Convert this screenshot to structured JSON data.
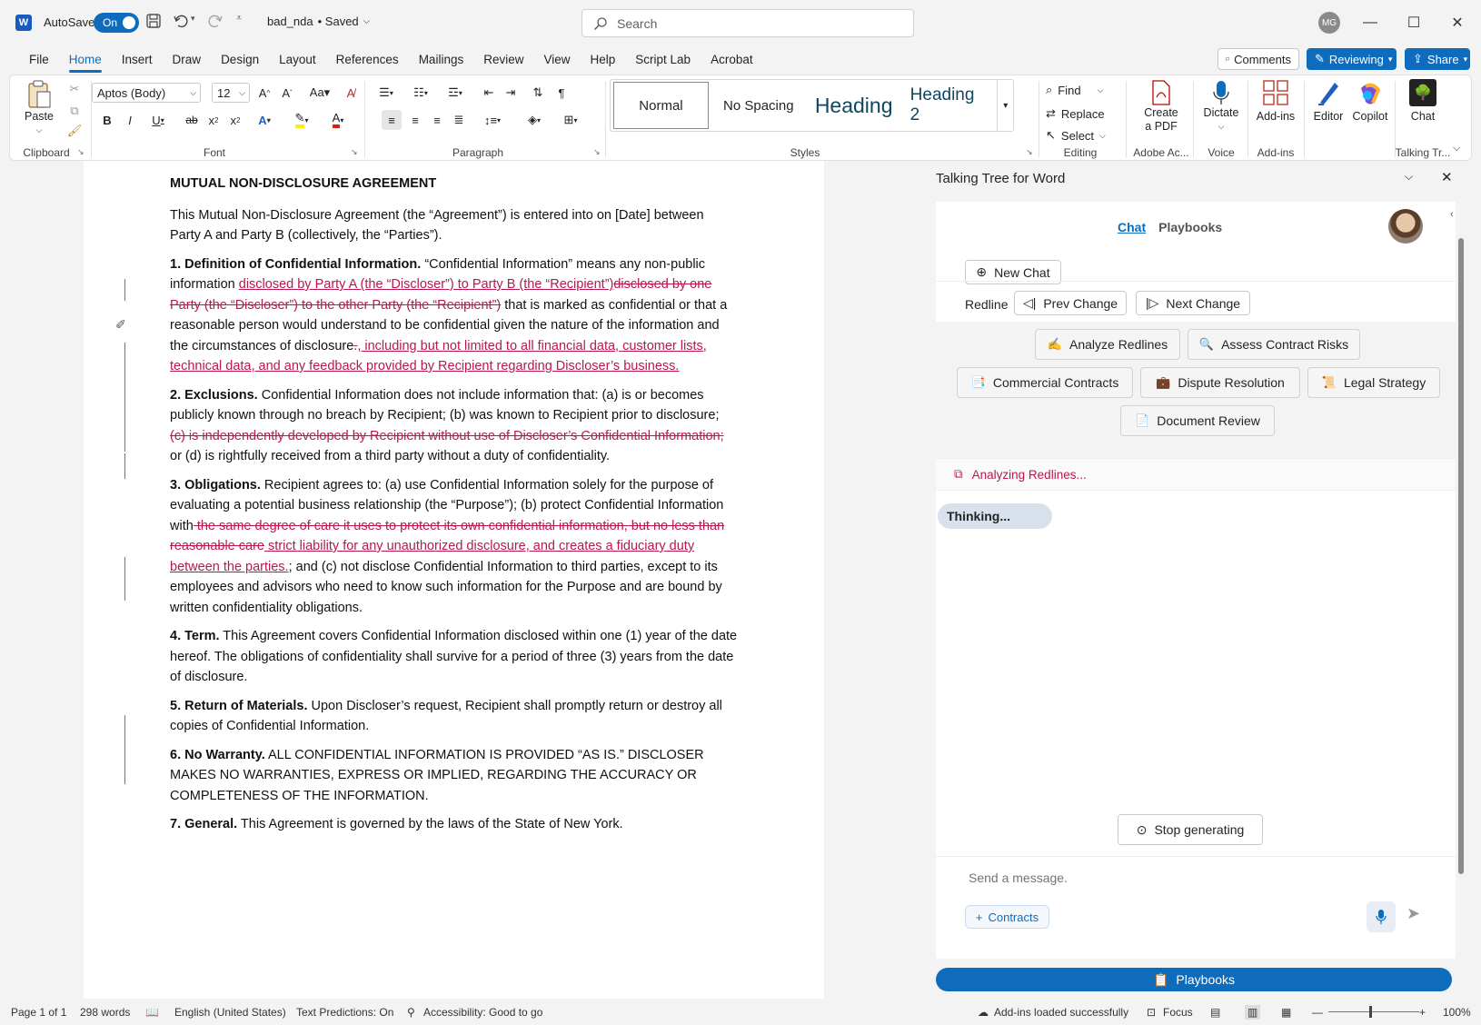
{
  "titlebar": {
    "autosave_label": "AutoSave",
    "autosave_state": "On",
    "doc_name": "bad_nda",
    "doc_status": "• Saved",
    "search_placeholder": "Search",
    "user_initials": "MG"
  },
  "menu": {
    "tabs": [
      "File",
      "Home",
      "Insert",
      "Draw",
      "Design",
      "Layout",
      "References",
      "Mailings",
      "Review",
      "View",
      "Help",
      "Script Lab",
      "Acrobat"
    ],
    "active": "Home",
    "comments": "Comments",
    "reviewing": "Reviewing",
    "share": "Share"
  },
  "ribbon": {
    "clipboard": {
      "paste": "Paste",
      "label": "Clipboard"
    },
    "font": {
      "name": "Aptos (Body)",
      "size": "12",
      "label": "Font"
    },
    "paragraph": {
      "label": "Paragraph"
    },
    "styles": {
      "items": [
        "Normal",
        "No Spacing",
        "Heading",
        "Heading 2"
      ],
      "label": "Styles"
    },
    "editing": {
      "find": "Find",
      "replace": "Replace",
      "select": "Select",
      "label": "Editing"
    },
    "adobe": {
      "create": "Create",
      "pdf": "a PDF",
      "label": "Adobe Ac..."
    },
    "voice": {
      "dictate": "Dictate",
      "label": "Voice"
    },
    "addins": {
      "addins": "Add-ins",
      "label": "Add-ins"
    },
    "editor": "Editor",
    "copilot": "Copilot",
    "talking": {
      "chat": "Chat",
      "label": "Talking Tr..."
    }
  },
  "document": {
    "title": "MUTUAL NON-DISCLOSURE AGREEMENT",
    "intro": "This Mutual Non-Disclosure Agreement (the “Agreement”) is entered into on [Date] between Party A and Party B (collectively, the “Parties”).",
    "s1": {
      "head": "1. Definition of Confidential Information.",
      "t1": " “Confidential Information” means any non-public information ",
      "ins1": "disclosed by Party A (the “Discloser”) to Party B (the “Recipient”)",
      "del1": "disclosed by one Party (the “Discloser”) to the other Party (the “Recipient”)",
      "t2": " that is marked as confidential or that a reasonable person would understand to be confidential given the nature of the information and the circumstances of disclosure",
      "del2": ".",
      "ins2": ", including but not limited to all financial data, customer lists, technical data, and any feedback provided by Recipient regarding Discloser’s business."
    },
    "s2": {
      "head": "2. Exclusions.",
      "t1": " Confidential Information does not include information that: (a) is or becomes publicly known through no breach by Recipient; (b) was known to Recipient prior to disclosure; ",
      "del1": "(c) is independently developed by Recipient without use of Discloser’s Confidential Information;",
      "t2": " or (d) is rightfully received from a third party without a duty of confidentiality."
    },
    "s3": {
      "head": "3. Obligations.",
      "t1": " Recipient agrees to: (a) use Confidential Information solely for the purpose of evaluating a potential business relationship (the “Purpose”); (b) protect Confidential Information with",
      "del1": " the same degree of care it uses to protect its own confidential information, but no less than reasonable care",
      "ins1": " strict liability for any unauthorized disclosure, and creates a fiduciary duty between the parties.",
      "t2": "; and (c) not disclose Confidential Information to third parties, except to its employees and advisors who need to know such information for the Purpose and are bound by written confidentiality obligations."
    },
    "s4": {
      "head": "4. Term.",
      "t1": " This Agreement covers Confidential Information disclosed within one (1) year of the date hereof. The obligations of confidentiality shall survive for a period of three (3) years from the date of disclosure."
    },
    "s5": {
      "head": "5. Return of Materials.",
      "t1": " Upon Discloser’s request, Recipient shall promptly return or destroy all copies of Confidential Information."
    },
    "s6": {
      "head": "6. No Warranty.",
      "t1": " ALL CONFIDENTIAL INFORMATION IS PROVIDED “AS IS.” DISCLOSER MAKES NO WARRANTIES, EXPRESS OR IMPLIED, REGARDING THE ACCURACY OR COMPLETENESS OF THE INFORMATION."
    },
    "s7": {
      "head": "7. General.",
      "t1": " This Agreement is governed by the laws of the State of New York."
    }
  },
  "pane": {
    "title": "Talking Tree for Word",
    "tab_chat": "Chat",
    "tab_playbooks": "Playbooks",
    "new_chat": "New Chat",
    "redline": "Redline",
    "prev_change": "Prev Change",
    "next_change": "Next Change",
    "actions": {
      "analyze": "Analyze Redlines",
      "assess": "Assess Contract Risks",
      "commercial": "Commercial Contracts",
      "dispute": "Dispute Resolution",
      "legal": "Legal Strategy",
      "review": "Document Review"
    },
    "emojis": {
      "analyze": "✍️",
      "assess": "🔍",
      "commercial": "📑",
      "dispute": "💼",
      "legal": "📜",
      "review": "📄"
    },
    "analyzing": "Analyzing Redlines...",
    "thinking": "Thinking...",
    "stop": "Stop generating",
    "message_placeholder": "Send a message.",
    "contracts": "Contracts",
    "playbooks_btn": "Playbooks"
  },
  "status": {
    "page": "Page 1 of 1",
    "words": "298 words",
    "language": "English (United States)",
    "predictions": "Text Predictions: On",
    "accessibility": "Accessibility: Good to go",
    "addins": "Add-ins loaded successfully",
    "focus": "Focus",
    "zoom": "100%"
  },
  "colors": {
    "accent": "#0f6cbd",
    "redline": "#b8194a"
  }
}
